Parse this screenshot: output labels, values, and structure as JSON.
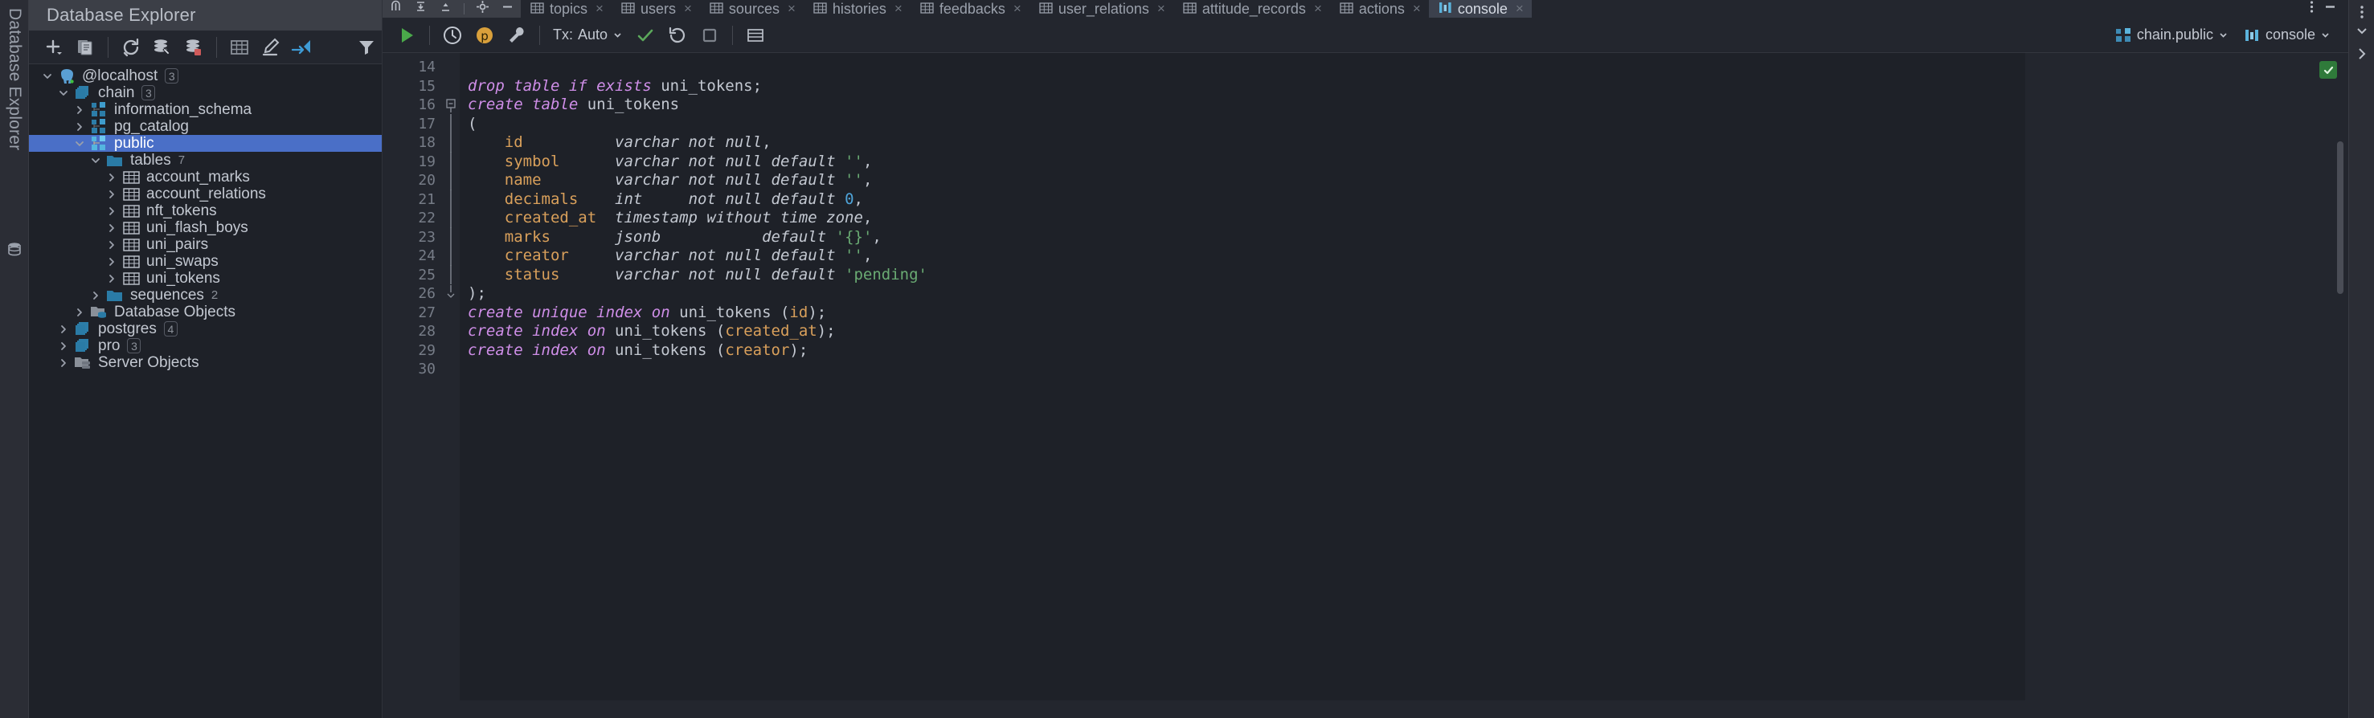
{
  "left_strip": {
    "vertical_label": "Database Explorer",
    "db_icon": "database-icon"
  },
  "db_explorer": {
    "title": "Database Explorer",
    "toolbar": [
      {
        "name": "add-button",
        "glyph": "+"
      },
      {
        "name": "copy-button",
        "glyph": "copy"
      },
      {
        "name": "refresh-button",
        "glyph": "refresh"
      },
      {
        "name": "data-source-properties-button",
        "glyph": "db-wrench"
      },
      {
        "name": "stop-database-button",
        "glyph": "db-stop"
      },
      {
        "name": "open-table-editor-button",
        "glyph": "grid"
      },
      {
        "name": "modify-button",
        "glyph": "pencil"
      },
      {
        "name": "jump-to-editor-button",
        "glyph": "arrows"
      },
      {
        "name": "filter-button",
        "glyph": "funnel"
      }
    ],
    "tree": [
      {
        "label": "@localhost",
        "badge": "3",
        "icon": "postgres-elephant-icon",
        "indent": 0,
        "expanded": true,
        "selected": false
      },
      {
        "label": "chain",
        "badge": "3",
        "icon": "database-stack-icon",
        "indent": 1,
        "expanded": true,
        "selected": false
      },
      {
        "label": "information_schema",
        "badge": "",
        "icon": "schema-icon",
        "indent": 2,
        "expanded": false,
        "selected": false
      },
      {
        "label": "pg_catalog",
        "badge": "",
        "icon": "schema-icon",
        "indent": 2,
        "expanded": false,
        "selected": false
      },
      {
        "label": "public",
        "badge": "",
        "icon": "schema-active-icon",
        "indent": 2,
        "expanded": true,
        "selected": true
      },
      {
        "label": "tables",
        "count": "7",
        "icon": "folder-icon",
        "indent": 3,
        "expanded": true,
        "selected": false
      },
      {
        "label": "account_marks",
        "icon": "table-icon",
        "indent": 4,
        "expanded": false,
        "selected": false
      },
      {
        "label": "account_relations",
        "icon": "table-icon",
        "indent": 4,
        "expanded": false,
        "selected": false
      },
      {
        "label": "nft_tokens",
        "icon": "table-icon",
        "indent": 4,
        "expanded": false,
        "selected": false
      },
      {
        "label": "uni_flash_boys",
        "icon": "table-icon",
        "indent": 4,
        "expanded": false,
        "selected": false
      },
      {
        "label": "uni_pairs",
        "icon": "table-icon",
        "indent": 4,
        "expanded": false,
        "selected": false
      },
      {
        "label": "uni_swaps",
        "icon": "table-icon",
        "indent": 4,
        "expanded": false,
        "selected": false
      },
      {
        "label": "uni_tokens",
        "icon": "table-icon",
        "indent": 4,
        "expanded": false,
        "selected": false
      },
      {
        "label": "sequences",
        "count": "2",
        "icon": "folder-icon",
        "indent": 3,
        "expanded": false,
        "selected": false
      },
      {
        "label": "Database Objects",
        "icon": "db-objects-icon",
        "indent": 2,
        "expanded": false,
        "selected": false
      },
      {
        "label": "postgres",
        "badge": "4",
        "icon": "database-stack-icon",
        "indent": 1,
        "expanded": false,
        "selected": false
      },
      {
        "label": "pro",
        "badge": "3",
        "icon": "database-stack-icon",
        "indent": 1,
        "expanded": false,
        "selected": false
      },
      {
        "label": "Server Objects",
        "icon": "server-objects-icon",
        "indent": 1,
        "expanded": false,
        "selected": false
      }
    ]
  },
  "editor": {
    "tab_strip_left_icons": [
      "hide-icon",
      "collapse-all-icon",
      "expand-all-icon",
      "settings-gear-icon",
      "minimize-icon"
    ],
    "tabs": [
      {
        "label": "topics",
        "icon": "table-icon",
        "active": false
      },
      {
        "label": "users",
        "icon": "table-icon",
        "active": false
      },
      {
        "label": "sources",
        "icon": "table-icon",
        "active": false
      },
      {
        "label": "histories",
        "icon": "table-icon",
        "active": false
      },
      {
        "label": "feedbacks",
        "icon": "table-icon",
        "active": false
      },
      {
        "label": "user_relations",
        "icon": "table-icon",
        "active": false
      },
      {
        "label": "attitude_records",
        "icon": "table-icon",
        "active": false
      },
      {
        "label": "actions",
        "icon": "table-icon",
        "active": false
      },
      {
        "label": "console",
        "icon": "console-icon",
        "active": true
      }
    ],
    "tab_close_glyph": "×",
    "tabs_right_icons": [
      "more-options-icon",
      "minimize-icon"
    ],
    "console_toolbar": {
      "execute_label": "execute-button",
      "history_label": "history-button",
      "explain_label": "explain-plan-button",
      "settings_label": "data-source-settings-button",
      "tx_label": "Tx:",
      "tx_value": "Auto",
      "commit_label": "commit-button",
      "rollback_label": "rollback-button",
      "stop_label": "stop-button",
      "table_label": "show-as-table-button",
      "schema_value": "chain.public",
      "session_value": "console"
    },
    "status_ok": "✓",
    "lines": [
      {
        "num": "14",
        "check": false,
        "fold": "",
        "code": ""
      },
      {
        "num": "15",
        "check": true,
        "fold": "",
        "code": "drop_table_if_exists_uni_tokens"
      },
      {
        "num": "16",
        "check": true,
        "fold": "start",
        "code": "create_table_uni_tokens"
      },
      {
        "num": "17",
        "check": false,
        "fold": "line",
        "code": "open_paren"
      },
      {
        "num": "18",
        "check": false,
        "fold": "line",
        "code": "col_id"
      },
      {
        "num": "19",
        "check": false,
        "fold": "line",
        "code": "col_symbol"
      },
      {
        "num": "20",
        "check": false,
        "fold": "line",
        "code": "col_name"
      },
      {
        "num": "21",
        "check": false,
        "fold": "line",
        "code": "col_decimals"
      },
      {
        "num": "22",
        "check": false,
        "fold": "line",
        "code": "col_created_at"
      },
      {
        "num": "23",
        "check": false,
        "fold": "line",
        "code": "col_marks"
      },
      {
        "num": "24",
        "check": false,
        "fold": "line",
        "code": "col_creator"
      },
      {
        "num": "25",
        "check": false,
        "fold": "line",
        "code": "col_status"
      },
      {
        "num": "26",
        "check": false,
        "fold": "end",
        "code": "close_paren"
      },
      {
        "num": "27",
        "check": true,
        "fold": "",
        "code": "idx_unique_id"
      },
      {
        "num": "28",
        "check": true,
        "fold": "",
        "code": "idx_created_at"
      },
      {
        "num": "29",
        "check": true,
        "fold": "",
        "code": "idx_creator"
      },
      {
        "num": "30",
        "check": false,
        "fold": "",
        "code": ""
      }
    ],
    "sql_text": {
      "l15": "drop table if exists uni_tokens;",
      "l16": "create table uni_tokens",
      "l17": "(",
      "l18": "    id          varchar not null,",
      "l19": "    symbol      varchar not null default '',",
      "l20": "    name        varchar not null default '',",
      "l21": "    decimals    int     not null default 0,",
      "l22": "    created_at  timestamp without time zone,",
      "l23": "    marks       jsonb           default '{}',",
      "l24": "    creator     varchar not null default '',",
      "l25": "    status      varchar not null default 'pending'",
      "l26": ");",
      "l27": "create unique index on uni_tokens (id);",
      "l28": "create index on uni_tokens (created_at);",
      "l29": "create index on uni_tokens (creator);"
    }
  },
  "colors": {
    "accent_blue": "#4a6fc7",
    "keyword_purple": "#cf8ee8",
    "identifier_orange": "#d9a05b",
    "string_green": "#6aab73",
    "number_blue": "#4ea3d8",
    "check_green": "#4aa94a",
    "panel_bg": "#1e2128",
    "toolbar_bg": "#23262e",
    "header_bg": "#3c3f47"
  }
}
